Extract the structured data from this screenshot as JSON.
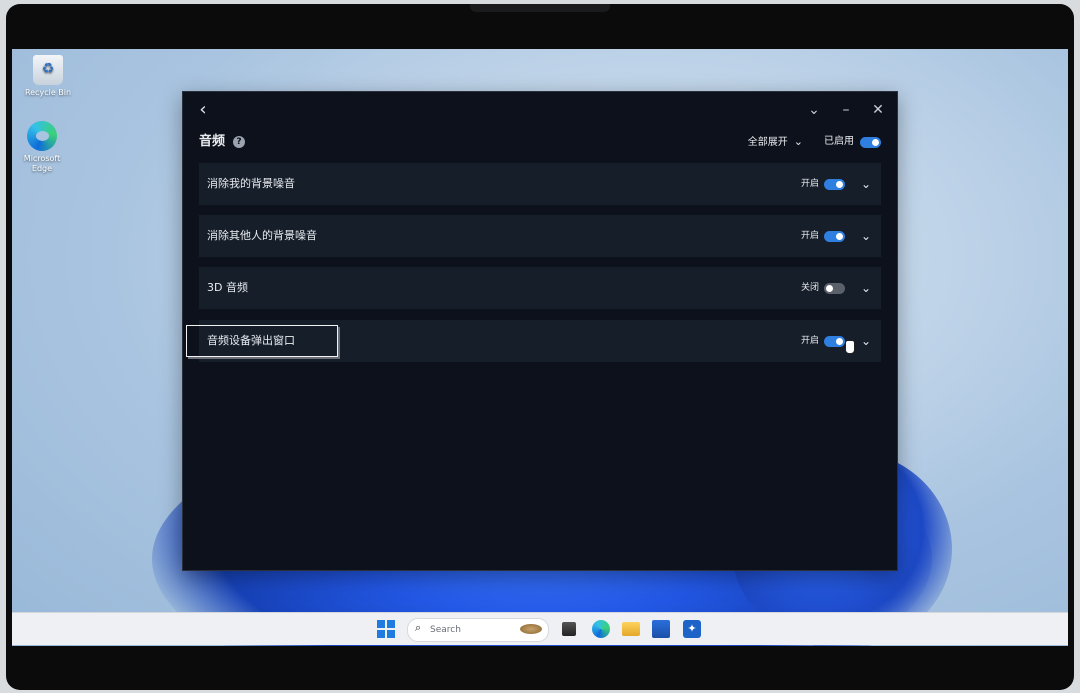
{
  "desktop": {
    "icons": [
      {
        "label": "Recycle Bin"
      },
      {
        "label": "Microsoft Edge"
      }
    ]
  },
  "window": {
    "back_glyph": "‹",
    "controls": {
      "collapse": "⌄",
      "minimize": "–",
      "close": "✕"
    }
  },
  "section": {
    "title": "音频",
    "help_glyph": "?",
    "expand_all_label": "全部展开",
    "enabled_label": "已启用",
    "enabled": true
  },
  "rows": [
    {
      "label": "消除我的背景噪音",
      "state": "开启",
      "on": true
    },
    {
      "label": "消除其他人的背景噪音",
      "state": "开启",
      "on": true
    },
    {
      "label": "3D 音频",
      "state": "关闭",
      "on": false
    },
    {
      "label": "音频设备弹出窗口",
      "state": "开启",
      "on": true,
      "focused": true
    }
  ],
  "taskbar": {
    "search_placeholder": "Search",
    "icons": [
      "windows-start-icon",
      "search-icon",
      "task-view-icon",
      "edge-icon",
      "file-explorer-icon",
      "store-icon",
      "app-icon"
    ]
  },
  "colors": {
    "accent": "#2f7fe0",
    "window_bg": "#0c111b",
    "row_bg": "#161e2a"
  }
}
